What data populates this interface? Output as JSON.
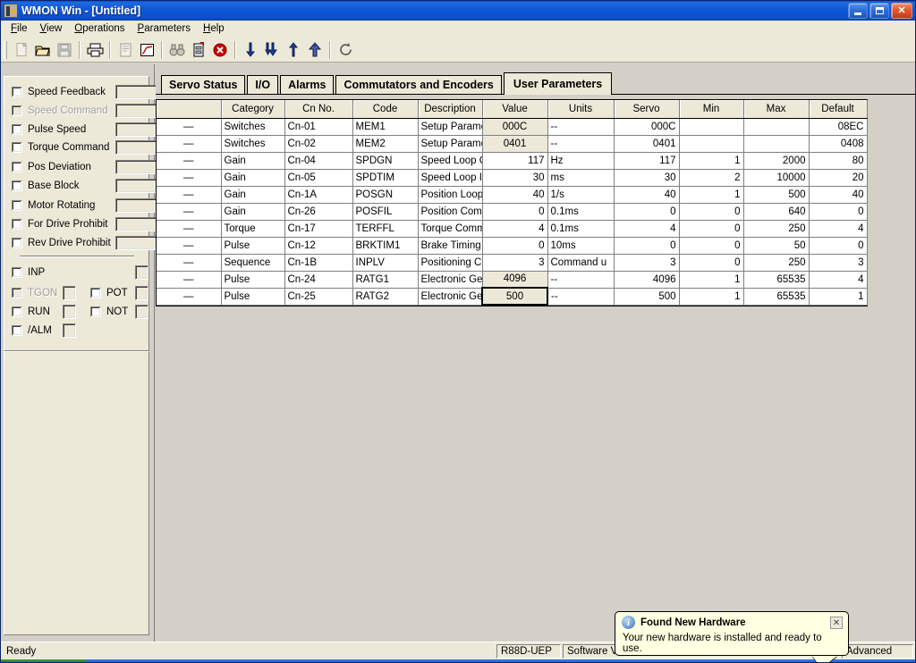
{
  "window": {
    "title_app": "WMON Win",
    "title_dash": " - ",
    "title_doc": "[Untitled]",
    "icon": "app-icon",
    "minimize_label": "_",
    "maximize_label": "❐",
    "close_label": "✕"
  },
  "menu": [
    {
      "label": "File"
    },
    {
      "label": "View"
    },
    {
      "label": "Operations"
    },
    {
      "label": "Parameters"
    },
    {
      "label": "Help"
    }
  ],
  "toolbar": {
    "buttons": [
      {
        "name": "new-icon",
        "glyph": "⬜",
        "disabled": true
      },
      {
        "name": "open-folder-icon",
        "glyph": "📂",
        "disabled": false
      },
      {
        "name": "save-disk-icon",
        "glyph": "💾",
        "disabled": true
      },
      {
        "name": "print-icon",
        "glyph": "🖨",
        "disabled": false
      },
      {
        "name": "report-icon",
        "glyph": "📑",
        "disabled": true
      },
      {
        "name": "trace-graph-icon",
        "glyph": "📈",
        "disabled": false
      },
      {
        "name": "find-binoculars-icon",
        "glyph": "🔍",
        "disabled": true
      },
      {
        "name": "parameter-edit-icon",
        "glyph": "📝",
        "disabled": false
      },
      {
        "name": "stop-alarm-icon",
        "glyph": "⛔",
        "disabled": false
      },
      {
        "name": "download-single-icon",
        "glyph": "↓",
        "disabled": false
      },
      {
        "name": "download-all-icon",
        "glyph": "⇓",
        "disabled": false
      },
      {
        "name": "upload-single-icon",
        "glyph": "↑",
        "disabled": false
      },
      {
        "name": "upload-all-icon",
        "glyph": "⇑",
        "disabled": false
      },
      {
        "name": "refresh-icon",
        "glyph": "↻",
        "disabled": false
      }
    ]
  },
  "sidebar": {
    "monitors": [
      {
        "label": "Speed Feedback",
        "checked": false,
        "disabled": false,
        "value": ""
      },
      {
        "label": "Speed Command",
        "checked": false,
        "disabled": true,
        "value": ""
      },
      {
        "label": "Pulse Speed",
        "checked": false,
        "disabled": false,
        "value": ""
      },
      {
        "label": "Torque Command",
        "checked": false,
        "disabled": false,
        "value": ""
      },
      {
        "label": "Pos Deviation",
        "checked": false,
        "disabled": false,
        "value": ""
      },
      {
        "label": "Base Block",
        "checked": false,
        "disabled": false,
        "value": ""
      },
      {
        "label": "Motor Rotating",
        "checked": false,
        "disabled": false,
        "value": ""
      },
      {
        "label": "For Drive Prohibit",
        "checked": false,
        "disabled": false,
        "value": ""
      },
      {
        "label": "Rev Drive Prohibit",
        "checked": false,
        "disabled": false,
        "value": ""
      }
    ],
    "signals_left": [
      {
        "label": "INP",
        "checked": false,
        "disabled": false
      },
      {
        "label": "TGON",
        "checked": false,
        "disabled": true
      },
      {
        "label": "RUN",
        "checked": false,
        "disabled": false
      },
      {
        "label": "/ALM",
        "checked": false,
        "disabled": false
      }
    ],
    "signals_right": [
      {
        "label": "POT",
        "checked": false,
        "disabled": false
      },
      {
        "label": "NOT",
        "checked": false,
        "disabled": false
      }
    ]
  },
  "tabs": [
    {
      "label": "Servo Status",
      "active": false
    },
    {
      "label": "I/O",
      "active": false
    },
    {
      "label": "Alarms",
      "active": false
    },
    {
      "label": "Commutators and Encoders",
      "active": false
    },
    {
      "label": "User Parameters",
      "active": true
    }
  ],
  "table": {
    "columns": [
      "",
      "Category",
      "Cn No.",
      "Code",
      "Description",
      "Value",
      "Units",
      "Servo",
      "Min",
      "Max",
      "Default"
    ],
    "rows": [
      {
        "marker": "—",
        "category": "Switches",
        "cn_no": "Cn-01",
        "code": "MEM1",
        "description": "Setup Parameter",
        "value": "000C",
        "value_style": "button",
        "units": "--",
        "servo": "000C",
        "min": "",
        "max": "",
        "default": "08EC"
      },
      {
        "marker": "—",
        "category": "Switches",
        "cn_no": "Cn-02",
        "code": "MEM2",
        "description": "Setup Parameter",
        "value": "0401",
        "value_style": "button",
        "units": "--",
        "servo": "0401",
        "min": "",
        "max": "",
        "default": "0408"
      },
      {
        "marker": "—",
        "category": "Gain",
        "cn_no": "Cn-04",
        "code": "SPDGN",
        "description": "Speed Loop Gain",
        "value": "117",
        "value_style": "plain",
        "units": "Hz",
        "servo": "117",
        "min": "1",
        "max": "2000",
        "default": "80"
      },
      {
        "marker": "—",
        "category": "Gain",
        "cn_no": "Cn-05",
        "code": "SPDTIM",
        "description": "Speed Loop Int",
        "value": "30",
        "value_style": "plain",
        "units": "ms",
        "servo": "30",
        "min": "2",
        "max": "10000",
        "default": "20"
      },
      {
        "marker": "—",
        "category": "Gain",
        "cn_no": "Cn-1A",
        "code": "POSGN",
        "description": "Position Loop",
        "value": "40",
        "value_style": "plain",
        "units": "1/s",
        "servo": "40",
        "min": "1",
        "max": "500",
        "default": "40"
      },
      {
        "marker": "—",
        "category": "Gain",
        "cn_no": "Cn-26",
        "code": "POSFIL",
        "description": "Position Comm",
        "value": "0",
        "value_style": "plain",
        "units": "0.1ms",
        "servo": "0",
        "min": "0",
        "max": "640",
        "default": "0"
      },
      {
        "marker": "—",
        "category": "Torque",
        "cn_no": "Cn-17",
        "code": "TERFFL",
        "description": "Torque Comma",
        "value": "4",
        "value_style": "plain",
        "units": "0.1ms",
        "servo": "4",
        "min": "0",
        "max": "250",
        "default": "4"
      },
      {
        "marker": "—",
        "category": "Pulse",
        "cn_no": "Cn-12",
        "code": "BRKTIM1",
        "description": "Brake Timing",
        "value": "0",
        "value_style": "plain",
        "units": "10ms",
        "servo": "0",
        "min": "0",
        "max": "50",
        "default": "0"
      },
      {
        "marker": "—",
        "category": "Sequence",
        "cn_no": "Cn-1B",
        "code": "INPLV",
        "description": "Positioning C",
        "value": "3",
        "value_style": "plain",
        "units": "Command u",
        "servo": "3",
        "min": "0",
        "max": "250",
        "default": "3"
      },
      {
        "marker": "—",
        "category": "Pulse",
        "cn_no": "Cn-24",
        "code": "RATG1",
        "description": "Electronic Ge",
        "value": "4096",
        "value_style": "button",
        "units": "--",
        "servo": "4096",
        "min": "1",
        "max": "65535",
        "default": "4"
      },
      {
        "marker": "—",
        "category": "Pulse",
        "cn_no": "Cn-25",
        "code": "RATG2",
        "description": "Electronic Ge",
        "value": "500",
        "value_style": "selected",
        "units": "--",
        "servo": "500",
        "min": "1",
        "max": "65535",
        "default": "1"
      }
    ]
  },
  "statusbar": {
    "message": "Ready",
    "model": "R88D-UEP",
    "software": "Software V",
    "mode": "Advanced"
  },
  "balloon": {
    "title": "Found New Hardware",
    "body": "Your new hardware is installed and ready to use.",
    "close_label": "✕",
    "icon": "info-icon"
  }
}
